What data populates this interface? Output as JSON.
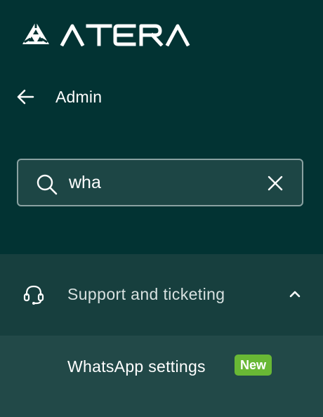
{
  "brand": {
    "logo_text": "ATERA",
    "logo_icon": "atera-triangle-icon"
  },
  "nav": {
    "back_icon": "arrow-left-icon",
    "back_label": "Admin"
  },
  "search": {
    "icon": "search-icon",
    "value": "wha",
    "clear_icon": "close-icon"
  },
  "section": {
    "icon": "headset-icon",
    "title": "Support and ticketing",
    "expanded": true,
    "chevron_icon": "chevron-up-icon",
    "items": [
      {
        "label": "WhatsApp settings",
        "badge": "New"
      }
    ]
  },
  "colors": {
    "background": "#023333",
    "section_bg": "#173f3e",
    "item_bg": "#224948",
    "search_bg": "#1d4645",
    "search_border": "#8aa2a2",
    "badge_bg": "#69b835",
    "text": "#ffffff"
  }
}
